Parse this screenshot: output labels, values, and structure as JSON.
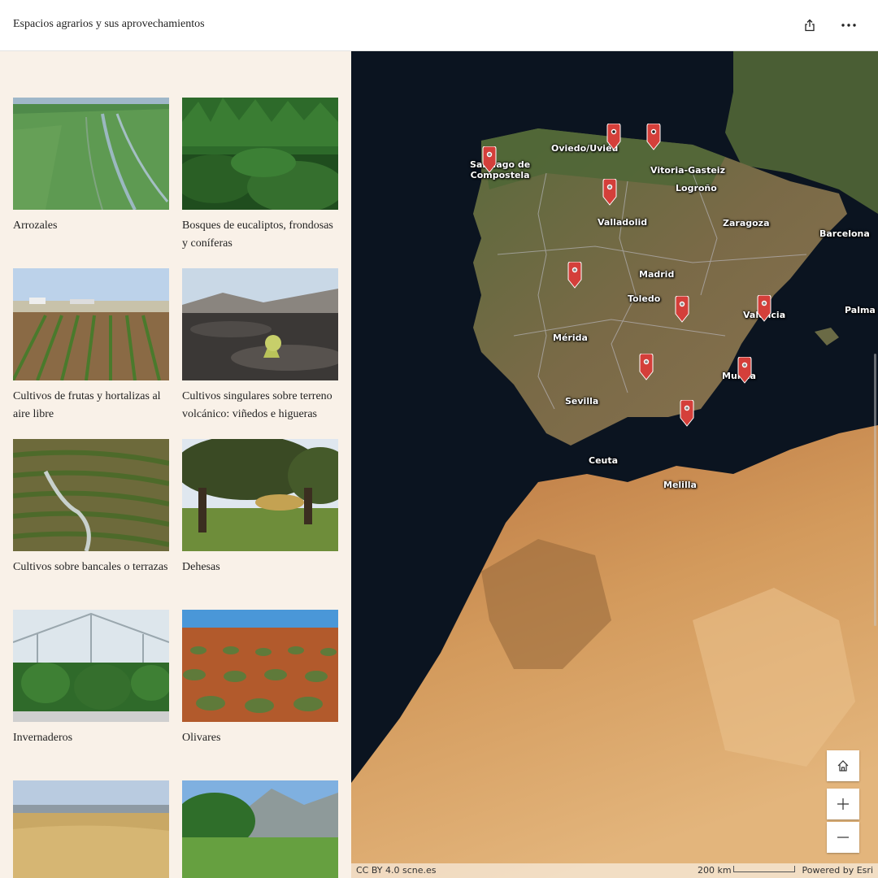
{
  "header": {
    "title": "Espacios agrarios y sus aprovechamientos",
    "share_icon": "share-icon",
    "more_icon": "more-horizontal-icon"
  },
  "gallery": {
    "items": [
      {
        "label": "Arrozales"
      },
      {
        "label": "Bosques de eucaliptos, frondosas y coníferas"
      },
      {
        "label": "Cultivos de frutas y hortalizas al aire libre"
      },
      {
        "label": "Cultivos singulares sobre terreno volcánico: viñedos e higueras"
      },
      {
        "label": "Cultivos sobre bancales o terrazas"
      },
      {
        "label": "Dehesas"
      },
      {
        "label": "Invernaderos"
      },
      {
        "label": "Olivares"
      },
      {
        "label": ""
      },
      {
        "label": ""
      }
    ]
  },
  "map": {
    "cities": [
      {
        "name": "Santiago de\nCompostela"
      },
      {
        "name": "Oviedo/Uviéu"
      },
      {
        "name": "Vitoria-Gasteiz"
      },
      {
        "name": "Logroño"
      },
      {
        "name": "Valladolid"
      },
      {
        "name": "Zaragoza"
      },
      {
        "name": "Barcelona"
      },
      {
        "name": "Madrid"
      },
      {
        "name": "Toledo"
      },
      {
        "name": "Valencia"
      },
      {
        "name": "Palma"
      },
      {
        "name": "Mérida"
      },
      {
        "name": "Murcia"
      },
      {
        "name": "Sevilla"
      },
      {
        "name": "Ceuta"
      },
      {
        "name": "Melilla"
      }
    ],
    "pin_color": "#d43f3a",
    "attribution": "CC BY 4.0 scne.es",
    "scale_label": "200 km",
    "powered_by": "Powered by Esri",
    "home_icon": "home-icon",
    "zoom_in_icon": "zoom-in-icon",
    "zoom_out_icon": "zoom-out-icon"
  }
}
